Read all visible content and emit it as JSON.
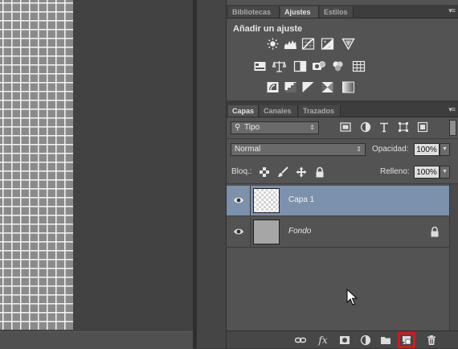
{
  "adjustments_panel": {
    "tabs": [
      {
        "label": "Bibliotecas",
        "active": false
      },
      {
        "label": "Ajustes",
        "active": true
      },
      {
        "label": "Estilos",
        "active": false
      }
    ],
    "title": "Añadir un ajuste",
    "icons": [
      "brightness-contrast-icon",
      "levels-icon",
      "curves-icon",
      "exposure-icon",
      "vibrance-icon",
      "hue-saturation-icon",
      "color-balance-icon",
      "black-white-icon",
      "photo-filter-icon",
      "channel-mixer-icon",
      "color-lookup-icon",
      "invert-icon",
      "posterize-icon",
      "threshold-icon",
      "selective-color-icon",
      "gradient-map-icon"
    ]
  },
  "layers_panel": {
    "tabs": [
      {
        "label": "Capas",
        "active": true
      },
      {
        "label": "Canales",
        "active": false
      },
      {
        "label": "Trazados",
        "active": false
      }
    ],
    "filter": {
      "label": "Tipo"
    },
    "blend_mode": "Normal",
    "opacity_label": "Opacidad:",
    "opacity_value": "100%",
    "lock_label": "Bloq.:",
    "fill_label": "Relleno:",
    "fill_value": "100%",
    "layers": [
      {
        "name": "Capa 1",
        "selected": true,
        "visible": true,
        "locked": false,
        "italic": false
      },
      {
        "name": "Fondo",
        "selected": false,
        "visible": true,
        "locked": true,
        "italic": true
      }
    ],
    "bottom_icons": [
      "link-layers-icon",
      "fx-icon",
      "layer-mask-icon",
      "adjustment-layer-icon",
      "group-folder-icon",
      "new-layer-icon",
      "trash-icon"
    ],
    "highlighted_button": "new-layer-icon"
  },
  "colors": {
    "selection": "#7c91ab",
    "highlight": "#e0141b",
    "panel_bg": "#535353"
  }
}
